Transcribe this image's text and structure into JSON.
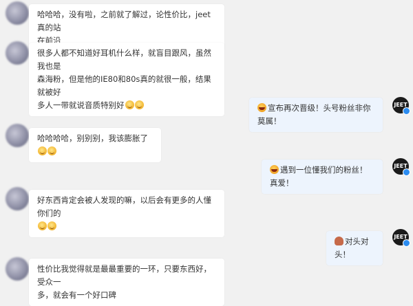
{
  "messages": [
    {
      "side": "left",
      "parts": [
        "哈哈哈，没有啦，之前就了解过，论性价比，jeet真的站",
        "在前沿"
      ]
    },
    {
      "side": "left",
      "parts": [
        "很多人都不知道好耳机什么样，就盲目跟风，虽然我也是",
        "森海粉，但是他的IE80和80s真的就很一般，结果就被好",
        "多人一带就说音质特别好"
      ],
      "emojis": 2
    },
    {
      "side": "right",
      "text": "宣布再次晋级！头号粉丝非你莫属！",
      "emoji": "laugh-icon"
    },
    {
      "side": "left",
      "text": "哈哈哈哈，别别别，我该膨胀了",
      "emojis": 2
    },
    {
      "side": "right",
      "text": "遇到一位懂我们的粉丝！真爱！",
      "emoji": "laugh-icon"
    },
    {
      "side": "left",
      "parts": [
        "好东西肯定会被人发现的嘛，以后会有更多的人懂你们的"
      ],
      "emojis": 2
    },
    {
      "side": "right",
      "text": "对头对头！",
      "emoji": "octopus-icon"
    },
    {
      "side": "left",
      "parts": [
        "性价比我觉得就是最最重要的一环，只要东西好，受众一",
        "多，就会有一个好口碑"
      ]
    }
  ],
  "brand_avatar_label": "JEET",
  "colors": {
    "background": "#f1f1f1",
    "bubble_left": "#ffffff",
    "bubble_right": "#edf4fd",
    "verify_badge": "#2c8cf0"
  }
}
